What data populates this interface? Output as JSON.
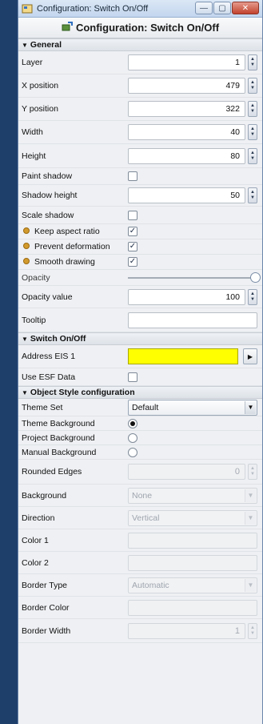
{
  "window": {
    "title": "Configuration: Switch On/Off",
    "header": "Configuration: Switch On/Off",
    "controls": {
      "minimize": "—",
      "maximize": "▢",
      "close": "✕"
    }
  },
  "general": {
    "title": "General",
    "layer": {
      "label": "Layer",
      "value": "1"
    },
    "x_position": {
      "label": "X position",
      "value": "479"
    },
    "y_position": {
      "label": "Y position",
      "value": "322"
    },
    "width": {
      "label": "Width",
      "value": "40"
    },
    "height": {
      "label": "Height",
      "value": "80"
    },
    "paint_shadow": {
      "label": "Paint shadow",
      "checked": false
    },
    "shadow_height": {
      "label": "Shadow height",
      "value": "50"
    },
    "scale_shadow": {
      "label": "Scale shadow",
      "checked": false
    },
    "keep_aspect_ratio": {
      "label": "Keep aspect ratio",
      "checked": true
    },
    "prevent_deformation": {
      "label": "Prevent deformation",
      "checked": true
    },
    "smooth_drawing": {
      "label": "Smooth drawing",
      "checked": true
    },
    "opacity": {
      "label": "Opacity",
      "level": 1.0
    },
    "opacity_value": {
      "label": "Opacity value",
      "value": "100"
    },
    "tooltip": {
      "label": "Tooltip",
      "value": ""
    }
  },
  "switch": {
    "title": "Switch On/Off",
    "address_eis1": {
      "label": "Address EIS 1",
      "color": "#ffff00"
    },
    "use_esf": {
      "label": "Use ESF Data",
      "checked": false
    }
  },
  "style": {
    "title": "Object Style configuration",
    "theme_set": {
      "label": "Theme Set",
      "value": "Default"
    },
    "theme_background": {
      "label": "Theme Background",
      "selected": true
    },
    "project_background": {
      "label": "Project Background",
      "selected": false
    },
    "manual_background": {
      "label": "Manual Background",
      "selected": false
    },
    "rounded_edges": {
      "label": "Rounded Edges",
      "value": "0"
    },
    "background": {
      "label": "Background",
      "value": "None"
    },
    "direction": {
      "label": "Direction",
      "value": "Vertical"
    },
    "color1": {
      "label": "Color 1"
    },
    "color2": {
      "label": "Color 2"
    },
    "border_type": {
      "label": "Border Type",
      "value": "Automatic"
    },
    "border_color": {
      "label": "Border Color"
    },
    "border_width": {
      "label": "Border Width",
      "value": "1"
    }
  },
  "glyphs": {
    "check": "✓",
    "triangle": "▼",
    "arrow_right": "▶",
    "spin_up": "▲",
    "spin_down": "▼"
  },
  "icons": {
    "app": "config-app-icon",
    "header": "switch-plugin-icon"
  },
  "colors": {
    "bullet": "#d29a2c",
    "address_field": "#ffff00"
  }
}
